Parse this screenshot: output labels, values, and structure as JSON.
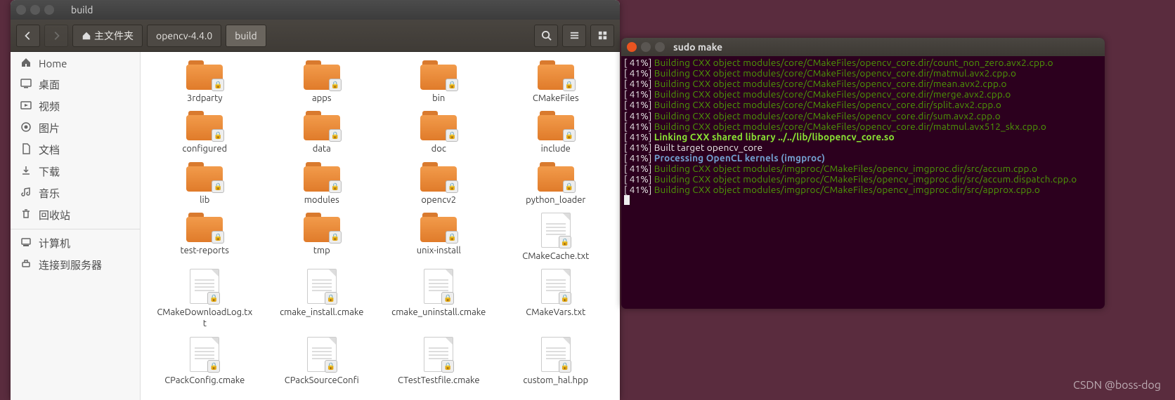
{
  "file_manager": {
    "title": "build",
    "nav": {
      "back": "‹",
      "forward": "›"
    },
    "breadcrumbs": [
      {
        "label": "主文件夹",
        "icon": "home"
      },
      {
        "label": "opencv-4.4.0"
      },
      {
        "label": "build",
        "active": true
      }
    ],
    "toolbar_icons": {
      "search": "search",
      "list": "list-view",
      "grid": "grid-view"
    }
  },
  "sidebar": {
    "items": [
      {
        "icon": "home",
        "label": "Home"
      },
      {
        "icon": "desktop",
        "label": "桌面"
      },
      {
        "icon": "video",
        "label": "视频"
      },
      {
        "icon": "pictures",
        "label": "图片"
      },
      {
        "icon": "documents",
        "label": "文档"
      },
      {
        "icon": "downloads",
        "label": "下载"
      },
      {
        "icon": "music",
        "label": "音乐"
      },
      {
        "icon": "trash",
        "label": "回收站"
      }
    ],
    "items2": [
      {
        "icon": "computer",
        "label": "计算机"
      },
      {
        "icon": "network",
        "label": "连接到服务器"
      }
    ]
  },
  "folders": [
    {
      "name": "3rdparty",
      "type": "folder"
    },
    {
      "name": "apps",
      "type": "folder"
    },
    {
      "name": "bin",
      "type": "folder"
    },
    {
      "name": "CMakeFiles",
      "type": "folder"
    },
    {
      "name": "configured",
      "type": "folder"
    },
    {
      "name": "data",
      "type": "folder"
    },
    {
      "name": "doc",
      "type": "folder"
    },
    {
      "name": "include",
      "type": "folder"
    },
    {
      "name": "lib",
      "type": "folder"
    },
    {
      "name": "modules",
      "type": "folder"
    },
    {
      "name": "opencv2",
      "type": "folder"
    },
    {
      "name": "python_loader",
      "type": "folder"
    },
    {
      "name": "test-reports",
      "type": "folder"
    },
    {
      "name": "tmp",
      "type": "folder"
    },
    {
      "name": "unix-install",
      "type": "folder"
    },
    {
      "name": "CMakeCache.txt",
      "type": "file"
    },
    {
      "name": "CMakeDownloadLog.txt",
      "type": "file"
    },
    {
      "name": "cmake_install.cmake",
      "type": "file"
    },
    {
      "name": "cmake_uninstall.cmake",
      "type": "file"
    },
    {
      "name": "CMakeVars.txt",
      "type": "file"
    },
    {
      "name": "CPackConfig.cmake",
      "type": "file"
    },
    {
      "name": "CPackSourceConfi",
      "type": "file"
    },
    {
      "name": "CTestTestfile.cmake",
      "type": "file"
    },
    {
      "name": "custom_hal.hpp",
      "type": "file"
    }
  ],
  "terminal": {
    "title": "sudo make",
    "lines": [
      {
        "pct": "41%",
        "cls": "green",
        "text": "Building CXX object modules/core/CMakeFiles/opencv_core.dir/count_non_zero.avx2.cpp.o"
      },
      {
        "pct": "41%",
        "cls": "green",
        "text": "Building CXX object modules/core/CMakeFiles/opencv_core.dir/matmul.avx2.cpp.o"
      },
      {
        "pct": "41%",
        "cls": "green",
        "text": "Building CXX object modules/core/CMakeFiles/opencv_core.dir/mean.avx2.cpp.o"
      },
      {
        "pct": "41%",
        "cls": "green",
        "text": "Building CXX object modules/core/CMakeFiles/opencv_core.dir/merge.avx2.cpp.o"
      },
      {
        "pct": "41%",
        "cls": "green",
        "text": "Building CXX object modules/core/CMakeFiles/opencv_core.dir/split.avx2.cpp.o"
      },
      {
        "pct": "41%",
        "cls": "green",
        "text": "Building CXX object modules/core/CMakeFiles/opencv_core.dir/sum.avx2.cpp.o"
      },
      {
        "pct": "41%",
        "cls": "green",
        "text": "Building CXX object modules/core/CMakeFiles/opencv_core.dir/matmul.avx512_skx.cpp.o"
      },
      {
        "pct": "41%",
        "cls": "bold-green",
        "text": "Linking CXX shared library ../../lib/libopencv_core.so"
      },
      {
        "pct": "41%",
        "cls": "white",
        "text": "Built target opencv_core"
      },
      {
        "pct": "41%",
        "cls": "blue",
        "text": "Processing OpenCL kernels (imgproc)"
      },
      {
        "pct": "41%",
        "cls": "green",
        "text": "Building CXX object modules/imgproc/CMakeFiles/opencv_imgproc.dir/src/accum.cpp.o"
      },
      {
        "pct": "41%",
        "cls": "green",
        "text": "Building CXX object modules/imgproc/CMakeFiles/opencv_imgproc.dir/src/accum.dispatch.cpp.o"
      },
      {
        "pct": "41%",
        "cls": "green",
        "text": "Building CXX object modules/imgproc/CMakeFiles/opencv_imgproc.dir/src/approx.cpp.o"
      }
    ]
  },
  "watermark": "CSDN @boss-dog"
}
